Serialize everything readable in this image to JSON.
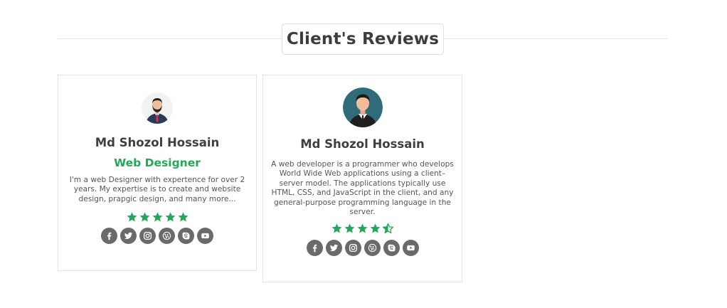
{
  "section": {
    "title": "Client's Reviews"
  },
  "colors": {
    "accent_green": "#26a65b",
    "star": "#26a65b",
    "social_bg": "#6a6a6a",
    "heading": "#3d3d3d"
  },
  "reviews": [
    {
      "name": "Md Shozol Hossain",
      "role": "Web Designer",
      "description": "I'm a web Designer with expertence for over 2 years. My expertise is to create and website design, prapgic design, and many more...",
      "rating": 5,
      "avatar_icon": "man-beard-suit-avatar",
      "socials": [
        "facebook-icon",
        "twitter-icon",
        "instagram-icon",
        "wordpress-icon",
        "skype-icon",
        "youtube-icon"
      ]
    },
    {
      "name": "Md Shozol Hossain",
      "description": "A web developer is a programmer who develops World Wide Web applications using a client–server model. The applications typically use HTML, CSS, and JavaScript in the client, and any general-purpose programming language in the server.",
      "rating": 4.5,
      "avatar_icon": "man-suit-teal-avatar",
      "socials": [
        "facebook-icon",
        "twitter-icon",
        "instagram-icon",
        "wordpress-icon",
        "skype-icon",
        "youtube-icon"
      ]
    }
  ]
}
